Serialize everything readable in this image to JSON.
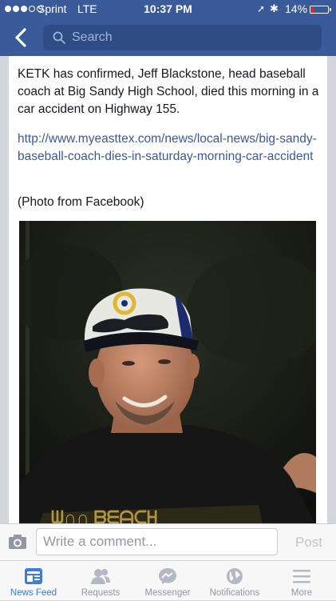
{
  "status_bar": {
    "carrier": "Sprint",
    "network": "LTE",
    "time": "10:37 PM",
    "battery_percent": "14%",
    "battery_level": 0.14,
    "signal_bars_filled": 3,
    "signal_bars_total": 5
  },
  "nav": {
    "back_icon": "chevron-left-icon",
    "search_placeholder": "Search"
  },
  "post": {
    "text": "KETK has confirmed, Jeff Blackstone, head baseball coach at Big Sandy High School, died this morning in a car accident on Highway 155.",
    "link": "http://www.myeasttex.com/news/local-news/big-sandy-baseball-coach-dies-in-saturday-morning-car-accident",
    "photo_credit": "(Photo from Facebook)"
  },
  "comment_bar": {
    "placeholder": "Write a comment...",
    "post_label": "Post"
  },
  "tabs": [
    {
      "label": "News Feed",
      "icon": "news-feed-icon",
      "active": true
    },
    {
      "label": "Requests",
      "icon": "friends-icon",
      "active": false
    },
    {
      "label": "Messenger",
      "icon": "messenger-icon",
      "active": false
    },
    {
      "label": "Notifications",
      "icon": "globe-icon",
      "active": false
    },
    {
      "label": "More",
      "icon": "menu-icon",
      "active": false
    }
  ],
  "colors": {
    "brand": "#3b5a99",
    "link": "#3b5998",
    "active_tab": "#3b7cde",
    "battery_low": "#e9262b"
  }
}
